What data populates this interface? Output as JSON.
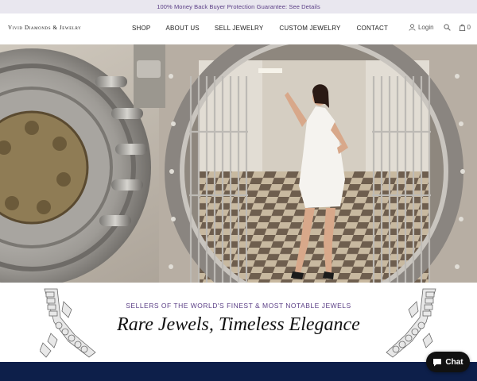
{
  "promo": {
    "text": "100% Money Back Buyer Protection Guarantee: See Details"
  },
  "header": {
    "logo": "Vivid Diamonds & Jewelry",
    "nav": [
      "SHOP",
      "ABOUT US",
      "SELL JEWELRY",
      "CUSTOM JEWELRY",
      "CONTACT"
    ],
    "login_label": "Login",
    "cart_count": "0",
    "icons": {
      "login": "user-icon",
      "search": "search-icon",
      "cart": "cart-icon"
    }
  },
  "hero": {
    "description_icon": "vault-photo"
  },
  "tagline": {
    "subheading": "SELLERS OF THE WORLD'S FINEST & MOST NOTABLE JEWELS",
    "headline": "Rare Jewels, Timeless Elegance"
  },
  "chat": {
    "label": "Chat",
    "icon": "chat-bubble-icon"
  },
  "colors": {
    "accent": "#5b3f86",
    "promo_bg": "#e9e7ef",
    "footer_bg": "#0d1f4a"
  }
}
